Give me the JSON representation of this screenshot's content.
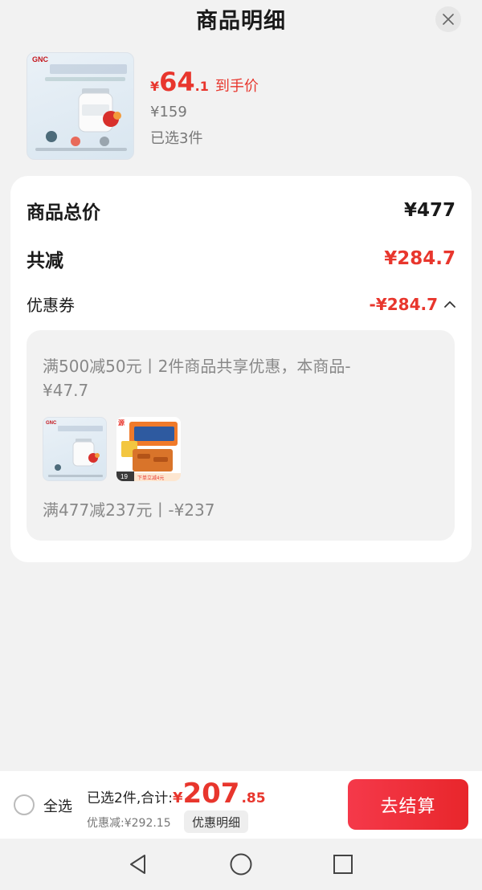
{
  "header": {
    "title": "商品明细"
  },
  "product": {
    "image_name": "gnc-coq10-product-image",
    "price_currency": "¥",
    "price_integer": "64",
    "price_decimal": ".1",
    "price_tag": "到手价",
    "original_price": "¥159",
    "selected_count": "已选3件"
  },
  "summary": {
    "total_label": "商品总价",
    "total_value": "¥477",
    "reduce_label": "共减",
    "reduce_value": "¥284.7",
    "coupon_label": "优惠券",
    "coupon_value": "-¥284.7"
  },
  "coupon_detail": {
    "line1": "满500减50元丨2件商品共享优惠，本商品-¥47.7",
    "items": [
      {
        "name": "gnc-coq10-thumb",
        "badge": ""
      },
      {
        "name": "snack-box-thumb",
        "badge": "19",
        "caption": "下单立减4元"
      }
    ],
    "line2": "满477减237元丨-¥237"
  },
  "bottom_bar": {
    "select_all": "全选",
    "total_prefix": "已选2件,合计:",
    "total_currency": "¥",
    "total_integer": "207",
    "total_decimal": ".85",
    "discount_text": "优惠减:¥292.15",
    "detail_button": "优惠明细",
    "checkout_button": "去结算"
  },
  "colors": {
    "accent": "#e8362d",
    "background": "#f2f2f2"
  }
}
